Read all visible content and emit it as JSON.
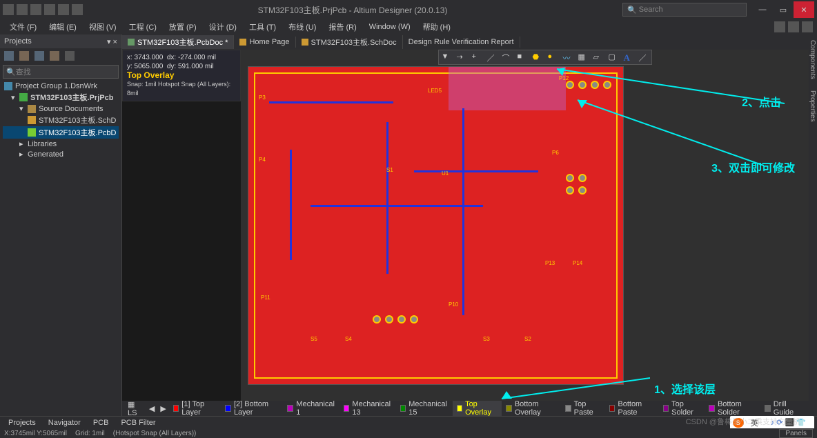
{
  "title": "STM32F103主板.PrjPcb - Altium Designer (20.0.13)",
  "search_placeholder": "Search",
  "menu": [
    "文件 (F)",
    "编辑 (E)",
    "视图 (V)",
    "工程 (C)",
    "放置 (P)",
    "设计 (D)",
    "工具 (T)",
    "布线 (U)",
    "报告 (R)",
    "Window (W)",
    "帮助 (H)"
  ],
  "projects": {
    "title": "Projects",
    "search_placeholder": "查找",
    "tree": {
      "group": "Project Group 1.DsnWrk",
      "project": "STM32F103主板.PrjPcb",
      "src_folder": "Source Documents",
      "sch": "STM32F103主板.SchD",
      "pcb": "STM32F103主板.PcbD",
      "libs": "Libraries",
      "gen": "Generated"
    }
  },
  "doc_tabs": [
    {
      "label": "STM32F103主板.PcbDoc *",
      "active": true
    },
    {
      "label": "Home Page"
    },
    {
      "label": "STM32F103主板.SchDoc"
    },
    {
      "label": "Design Rule Verification Report"
    }
  ],
  "coords": {
    "x": "x: 3743.000",
    "dx": "dx:  -274.000 mil",
    "y": "y: 5065.000",
    "dy": "dy:   591.000 mil",
    "layer": "Top Overlay",
    "snap": "Snap: 1mil Hotspot Snap (All Layers): 8mil"
  },
  "annotations": {
    "a1": "1、选择该层",
    "a2": "2、点击",
    "a3": "3、双击即可修改"
  },
  "layers": [
    {
      "c": "#f00",
      "t": "[1] Top Layer"
    },
    {
      "c": "#00f",
      "t": "[2] Bottom Layer"
    },
    {
      "c": "#b0b",
      "t": "Mechanical 1"
    },
    {
      "c": "#f0f",
      "t": "Mechanical 13"
    },
    {
      "c": "#080",
      "t": "Mechanical 15"
    },
    {
      "c": "#ff0",
      "t": "Top Overlay",
      "active": true
    },
    {
      "c": "#880",
      "t": "Bottom Overlay"
    },
    {
      "c": "#888",
      "t": "Top Paste"
    },
    {
      "c": "#800",
      "t": "Bottom Paste"
    },
    {
      "c": "#808",
      "t": "Top Solder"
    },
    {
      "c": "#b0b",
      "t": "Bottom Solder"
    },
    {
      "c": "#666",
      "t": "Drill Guide"
    }
  ],
  "panel_tabs": [
    "Projects",
    "Navigator",
    "PCB",
    "PCB Filter"
  ],
  "layer_ctrl": "LS",
  "status": {
    "pos": "X:3745mil Y:5065mil",
    "grid": "Grid: 1mil",
    "snap": "(Hotspot Snap (All Layers))",
    "panels": "Panels"
  },
  "side_tabs": [
    "Components",
    "Properties"
  ],
  "watermark": "CSDN @鲁棒最小二乘支持向量机",
  "lang": "英"
}
